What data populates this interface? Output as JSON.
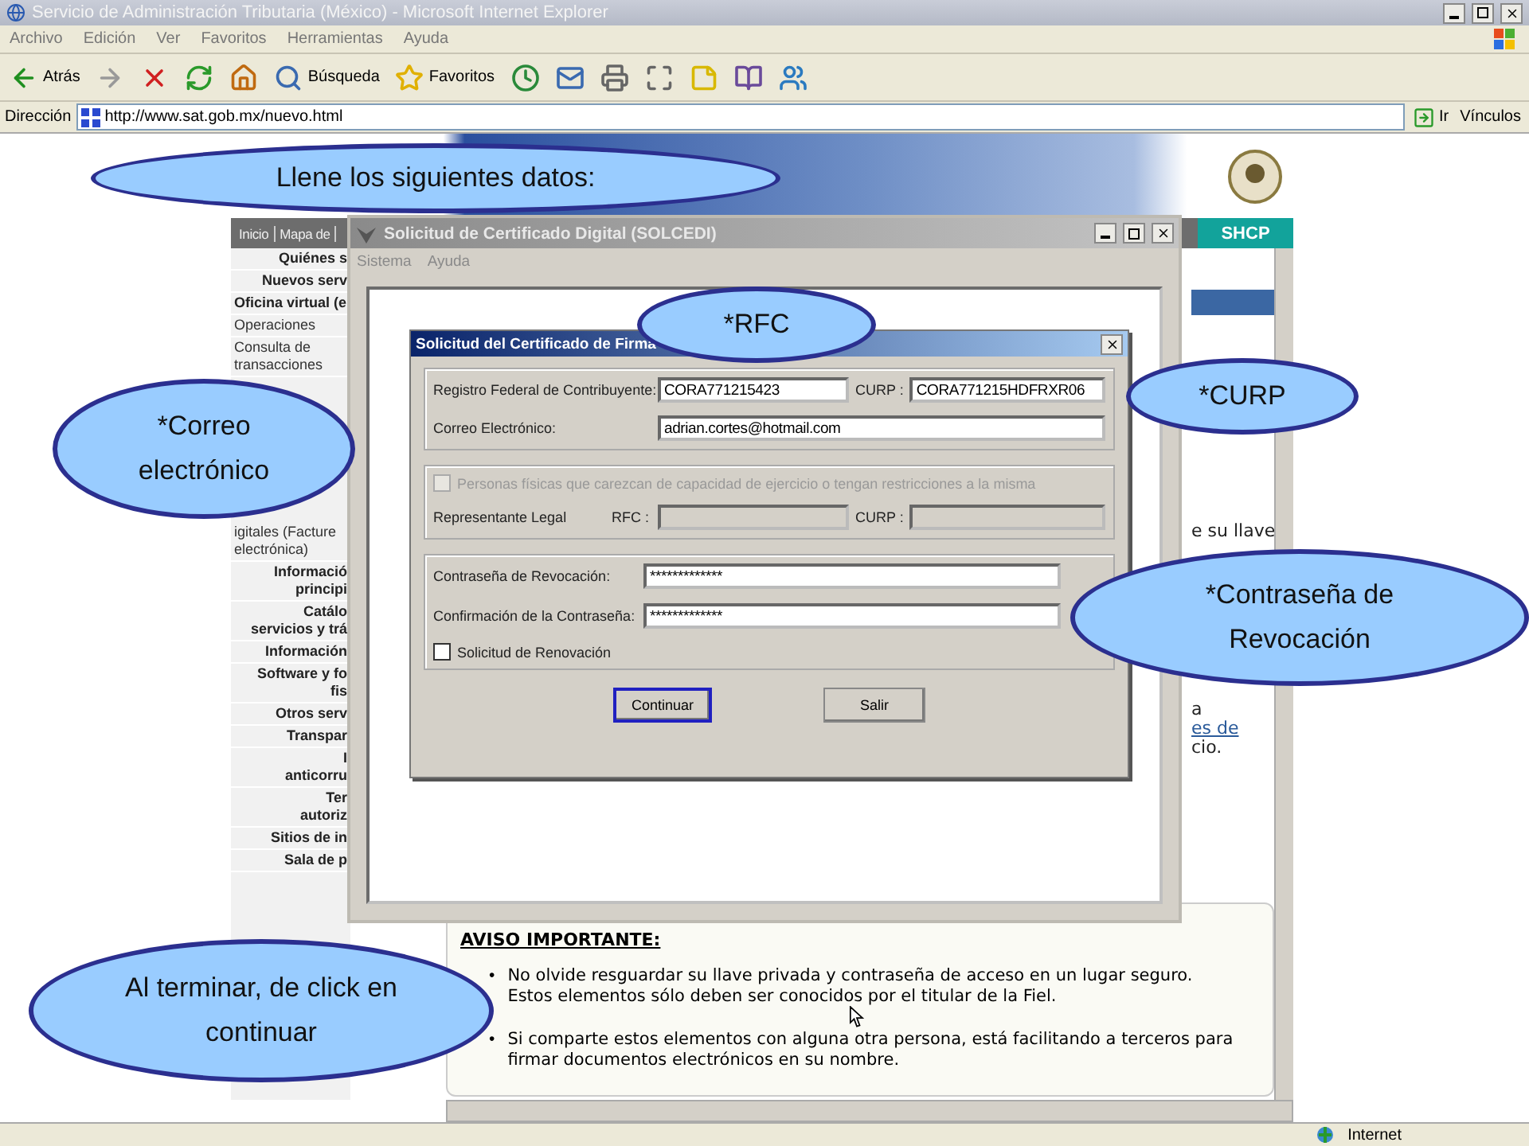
{
  "browser": {
    "title": "Servicio de Administración Tributaria (México) - Microsoft Internet Explorer",
    "menu": [
      "Archivo",
      "Edición",
      "Ver",
      "Favoritos",
      "Herramientas",
      "Ayuda"
    ],
    "toolbar": [
      {
        "kind": "back",
        "label": "Atrás"
      },
      {
        "kind": "forward"
      },
      {
        "kind": "stop"
      },
      {
        "kind": "refresh"
      },
      {
        "kind": "home"
      },
      {
        "kind": "search",
        "label": "Búsqueda"
      },
      {
        "kind": "favorites",
        "label": "Favoritos"
      },
      {
        "kind": "history"
      },
      {
        "kind": "mail"
      },
      {
        "kind": "print"
      },
      {
        "kind": "fullscreen"
      },
      {
        "kind": "note"
      },
      {
        "kind": "research"
      },
      {
        "kind": "messenger"
      }
    ],
    "address_label": "Dirección",
    "url": "http://www.sat.gob.mx/nuevo.html",
    "go": "Ir",
    "links": "Vínculos",
    "zone": "Internet"
  },
  "page": {
    "nav": [
      "Inicio",
      "Mapa de"
    ],
    "logo": "SHCP",
    "sidebar": {
      "upper": [
        {
          "kind": "heading",
          "label": "Quiénes s"
        },
        {
          "kind": "heading",
          "label": "Nuevos serv"
        },
        {
          "kind": "section",
          "label": "Oficina virtual (e"
        },
        {
          "kind": "link",
          "label": "Operaciones"
        },
        {
          "kind": "link",
          "label": "Consulta de\ntransacciones"
        }
      ],
      "lower": [
        {
          "kind": "link",
          "label": "igitales (Facture\nelectrónica)"
        },
        {
          "kind": "heading",
          "label": "Informació\nprincipi"
        },
        {
          "kind": "heading",
          "label": "Catálo\nservicios y trá"
        },
        {
          "kind": "heading",
          "label": "Información"
        },
        {
          "kind": "heading",
          "label": "Software y fo\nfis"
        },
        {
          "kind": "heading",
          "label": "Otros serv"
        },
        {
          "kind": "heading",
          "label": "Transpar"
        },
        {
          "kind": "heading",
          "label": "I\nanticorru"
        },
        {
          "kind": "heading",
          "label": "Ter\nautoriz"
        },
        {
          "kind": "heading",
          "label": "Sitios de in"
        },
        {
          "kind": "heading",
          "label": "Sala de p"
        }
      ]
    },
    "fragments": [
      {
        "kind": "text",
        "label": "e su llave"
      },
      {
        "kind": "text",
        "label": "a"
      },
      {
        "kind": "link",
        "label": "es de"
      },
      {
        "kind": "text",
        "label": "cio."
      }
    ],
    "notice": {
      "title": "AVISO IMPORTANTE:",
      "bullet": "•",
      "items": [
        "No olvide resguardar su llave privada y contraseña de acceso en un lugar seguro. Estos elementos sólo deben ser conocidos por el titular de la Fiel.",
        "Si comparte estos elementos con alguna otra persona, está facilitando a terceros para firmar documentos electrónicos en su nombre."
      ]
    }
  },
  "app_window": {
    "title": "Solicitud de Certificado Digital (SOLCEDI)",
    "menu": [
      "Sistema",
      "Ayuda"
    ]
  },
  "form": {
    "title": "Solicitud del Certificado de Firma",
    "rfc_label": "Registro Federal de Contribuyente:",
    "rfc": "CORA771215423",
    "curp_label": "CURP :",
    "curp": "CORA771215HDFRXR06",
    "email_label": "Correo Electrónico:",
    "email": "adrian.cortes@hotmail.com",
    "minor": {
      "label": "Personas físicas que carezcan de capacidad de ejercicio o tengan restricciones a la misma",
      "checked": false,
      "disabled": true
    },
    "rep_label": "Representante Legal",
    "rep_rfc_label": "RFC :",
    "rep_curp_label": "CURP :",
    "password_label": "Contraseña de Revocación:",
    "password": "*************",
    "confirm_label": "Confirmación de la Contraseña:",
    "confirm": "*************",
    "renewal": {
      "label": "Solicitud de Renovación",
      "checked": false
    },
    "buttons": [
      {
        "label": "Continuar",
        "focused": true
      },
      {
        "label": "Salir",
        "focused": false
      }
    ]
  },
  "callouts": [
    "Llene los siguientes datos:",
    "*RFC",
    "*CURP",
    "*Correo electrónico",
    "*Contraseña de Revocación",
    "Al terminar, de click en   continuar"
  ]
}
